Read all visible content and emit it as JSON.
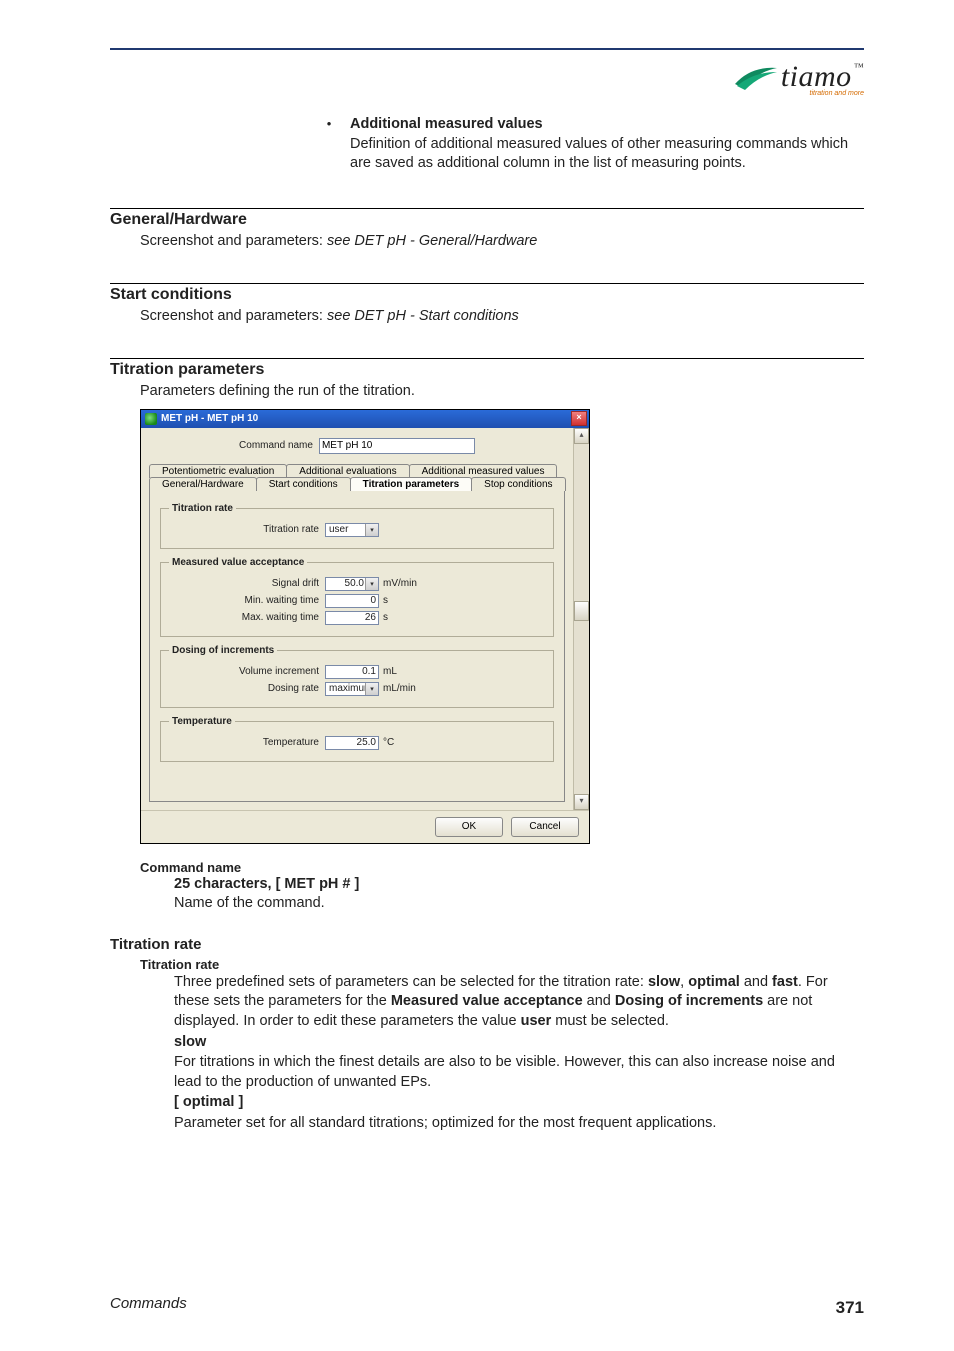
{
  "logo": {
    "name": "tiamo",
    "tagline": "titration and more"
  },
  "bullet": {
    "title": "Additional measured values",
    "text": "Definition of additional measured values of other measuring commands which are saved as additional column in the list of measuring points."
  },
  "sections": {
    "general_hw": {
      "heading": "General/Hardware",
      "lead": "Screenshot and parameters: ",
      "ref": "see DET pH - General/Hardware"
    },
    "start_cond": {
      "heading": "Start conditions",
      "lead": "Screenshot and parameters: ",
      "ref": "see DET pH - Start conditions"
    },
    "titr_params": {
      "heading": "Titration parameters",
      "lead": "Parameters defining the run of the titration."
    }
  },
  "dialog": {
    "title": "MET pH - MET pH 10",
    "command_name_label": "Command name",
    "command_name_value": "MET pH 10",
    "tabs_top": [
      "Potentiometric evaluation",
      "Additional evaluations",
      "Additional measured values"
    ],
    "tabs_bot": [
      "General/Hardware",
      "Start conditions",
      "Titration parameters",
      "Stop conditions"
    ],
    "active_tab": "Titration parameters",
    "groups": {
      "titration_rate": {
        "legend": "Titration rate",
        "rate_label": "Titration rate",
        "rate_value": "user"
      },
      "mva": {
        "legend": "Measured value acceptance",
        "signal_drift_label": "Signal drift",
        "signal_drift_value": "50.0",
        "signal_drift_unit": "mV/min",
        "min_wait_label": "Min. waiting time",
        "min_wait_value": "0",
        "min_wait_unit": "s",
        "max_wait_label": "Max. waiting time",
        "max_wait_value": "26",
        "max_wait_unit": "s"
      },
      "dosing": {
        "legend": "Dosing of increments",
        "vol_inc_label": "Volume increment",
        "vol_inc_value": "0.1",
        "vol_inc_unit": "mL",
        "dosing_rate_label": "Dosing rate",
        "dosing_rate_value": "maximum",
        "dosing_rate_unit": "mL/min"
      },
      "temperature": {
        "legend": "Temperature",
        "temp_label": "Temperature",
        "temp_value": "25.0",
        "temp_unit": "°C"
      }
    },
    "ok": "OK",
    "cancel": "Cancel"
  },
  "post": {
    "cmd_name_term": "Command name",
    "cmd_name_spec": "25 characters, [ MET pH # ]",
    "cmd_name_desc": "Name of the command.",
    "titr_rate_heading": "Titration rate",
    "titr_rate_term": "Titration rate",
    "titr_rate_intro": "Three predefined sets of parameters can be selected for the titration rate: ",
    "slow": "slow",
    "optimal": "optimal",
    "fast": "fast",
    "and1": ", ",
    "and2": " and ",
    "sentence_tail": ". For these sets the parameters for the ",
    "mva_b": "Measured value acceptance",
    "and3": " and ",
    "doi_b": "Dosing of increments",
    "tail2": " are not displayed. In order to edit these parameters the value ",
    "user_b": "user",
    "tail3": " must be selected.",
    "slow_term": "slow",
    "slow_desc": "For titrations in which the finest details are also to be visible. However, this can also increase noise and lead to the production of unwanted EPs.",
    "optimal_term": "[ optimal ]",
    "optimal_desc": "Parameter set for all standard titrations; optimized for the most frequent applications."
  },
  "footer": {
    "left": "Commands",
    "right": "371"
  }
}
